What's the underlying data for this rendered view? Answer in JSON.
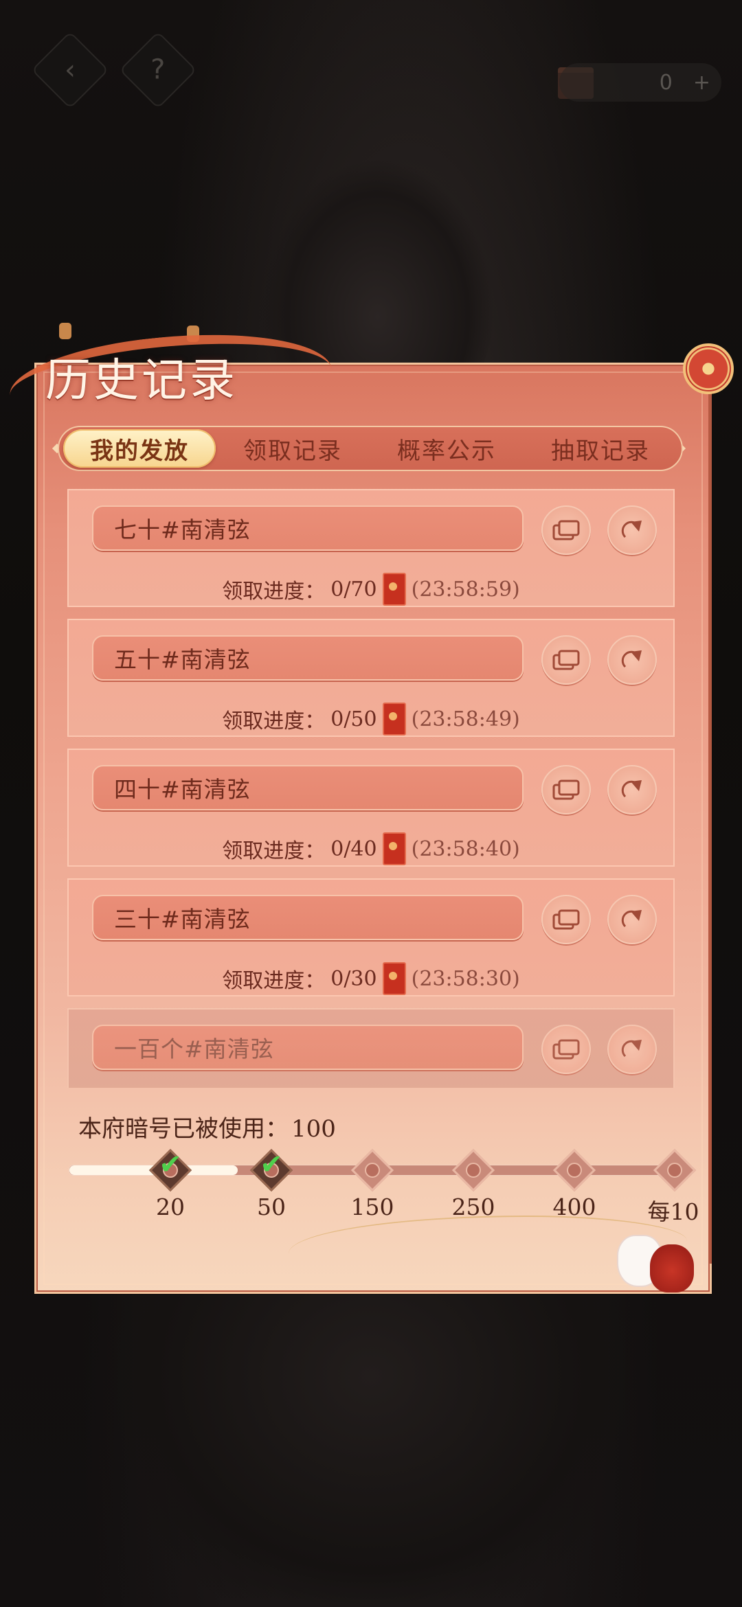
{
  "topbar": {
    "back_icon": "back-arrow-icon",
    "help_label": "?",
    "currency_value": "0",
    "add_label": "+"
  },
  "panel": {
    "title": "历史记录"
  },
  "tabs": [
    {
      "label": "我的发放",
      "active": true
    },
    {
      "label": "领取记录",
      "active": false
    },
    {
      "label": "概率公示",
      "active": false
    },
    {
      "label": "抽取记录",
      "active": false
    }
  ],
  "records": [
    {
      "name": "七十#南清弦",
      "progress_label": "领取进度：",
      "progress": "0/70",
      "timer": "(23:58:59)"
    },
    {
      "name": "五十#南清弦",
      "progress_label": "领取进度：",
      "progress": "0/50",
      "timer": "(23:58:49)"
    },
    {
      "name": "四十#南清弦",
      "progress_label": "领取进度：",
      "progress": "0/40",
      "timer": "(23:58:40)"
    },
    {
      "name": "三十#南清弦",
      "progress_label": "领取进度：",
      "progress": "0/30",
      "timer": "(23:58:30)"
    },
    {
      "name": "一百个#南清弦"
    }
  ],
  "usage": {
    "label": "本府暗号已被使用：",
    "value": "100",
    "fill_fraction": 0.27
  },
  "milestones": [
    {
      "label": "20",
      "done": true
    },
    {
      "label": "50",
      "done": true
    },
    {
      "label": "150",
      "done": false
    },
    {
      "label": "250",
      "done": false
    },
    {
      "label": "400",
      "done": false
    },
    {
      "label": "每10",
      "done": false
    }
  ],
  "colors": {
    "accent": "#e1683e",
    "active_tab": "#f7d58e",
    "check": "#4fd04c"
  }
}
